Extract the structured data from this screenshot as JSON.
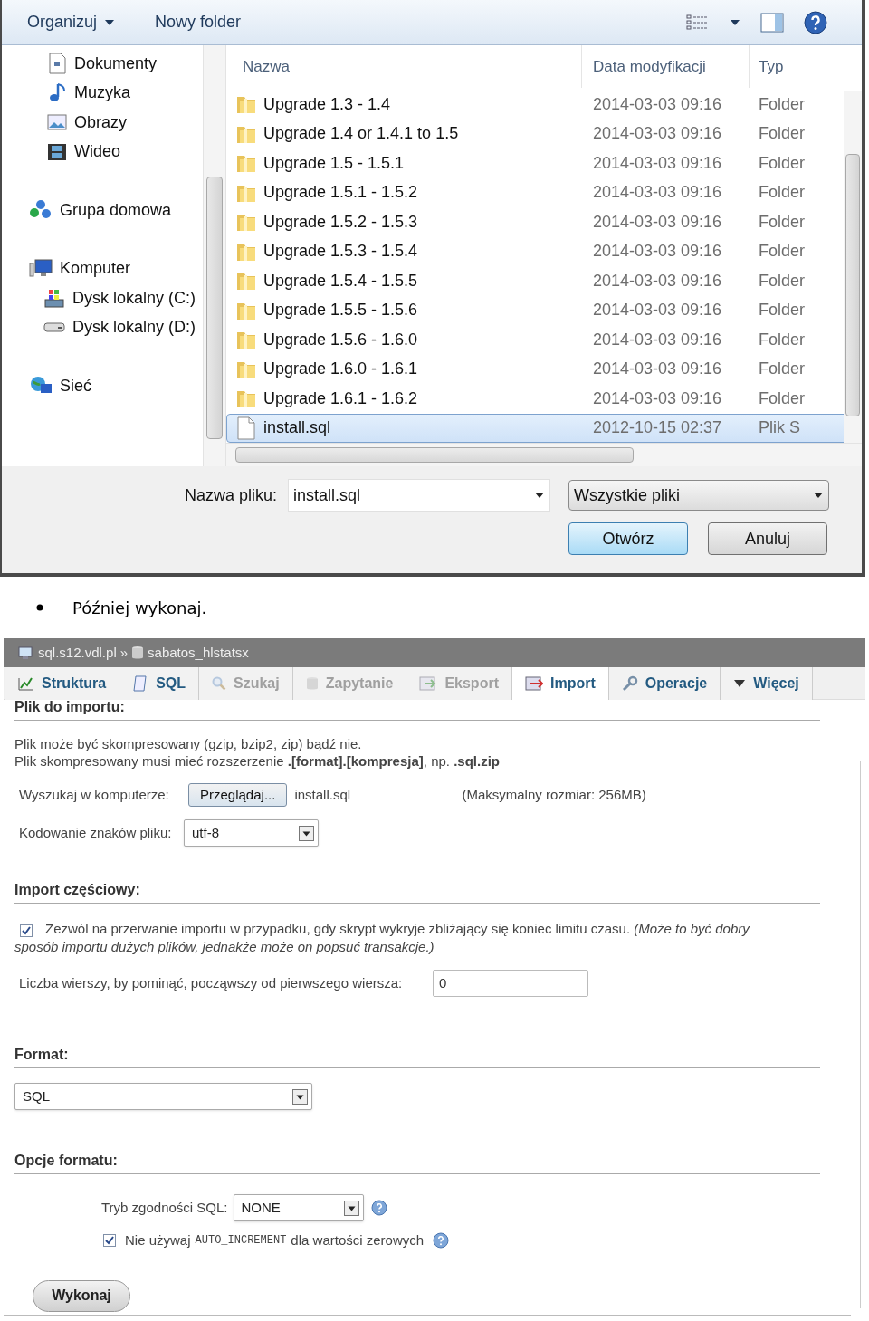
{
  "dialog": {
    "toolbar": {
      "organize": "Organizuj",
      "new_folder": "Nowy folder"
    },
    "nav": [
      {
        "children": [
          {
            "label": "Dokumenty"
          },
          {
            "label": "Muzyka"
          },
          {
            "label": "Obrazy"
          },
          {
            "label": "Wideo"
          }
        ]
      },
      {
        "label": "Grupa domowa"
      },
      {
        "label": "Komputer",
        "children": [
          {
            "label": "Dysk lokalny (C:)"
          },
          {
            "label": "Dysk lokalny (D:)"
          }
        ]
      },
      {
        "label": "Sieć"
      }
    ],
    "columns": [
      "Nazwa",
      "Data modyfikacji",
      "Typ"
    ],
    "rows": [
      {
        "name": "Upgrade 1.3 - 1.4",
        "date": "2014-03-03 09:16",
        "type": "Folder",
        "kind": "folder",
        "selected": false
      },
      {
        "name": "Upgrade 1.4 or 1.4.1 to 1.5",
        "date": "2014-03-03 09:16",
        "type": "Folder",
        "kind": "folder",
        "selected": false
      },
      {
        "name": "Upgrade 1.5 - 1.5.1",
        "date": "2014-03-03 09:16",
        "type": "Folder",
        "kind": "folder",
        "selected": false
      },
      {
        "name": "Upgrade 1.5.1 - 1.5.2",
        "date": "2014-03-03 09:16",
        "type": "Folder",
        "kind": "folder",
        "selected": false
      },
      {
        "name": "Upgrade 1.5.2 - 1.5.3",
        "date": "2014-03-03 09:16",
        "type": "Folder",
        "kind": "folder",
        "selected": false
      },
      {
        "name": "Upgrade 1.5.3 - 1.5.4",
        "date": "2014-03-03 09:16",
        "type": "Folder",
        "kind": "folder",
        "selected": false
      },
      {
        "name": "Upgrade 1.5.4 - 1.5.5",
        "date": "2014-03-03 09:16",
        "type": "Folder",
        "kind": "folder",
        "selected": false
      },
      {
        "name": "Upgrade 1.5.5 - 1.5.6",
        "date": "2014-03-03 09:16",
        "type": "Folder",
        "kind": "folder",
        "selected": false
      },
      {
        "name": "Upgrade 1.5.6 - 1.6.0",
        "date": "2014-03-03 09:16",
        "type": "Folder",
        "kind": "folder",
        "selected": false
      },
      {
        "name": "Upgrade 1.6.0 - 1.6.1",
        "date": "2014-03-03 09:16",
        "type": "Folder",
        "kind": "folder",
        "selected": false
      },
      {
        "name": "Upgrade 1.6.1 - 1.6.2",
        "date": "2014-03-03 09:16",
        "type": "Folder",
        "kind": "folder",
        "selected": false
      },
      {
        "name": "install.sql",
        "date": "2012-10-15 02:37",
        "type": "Plik S",
        "kind": "file",
        "selected": true
      }
    ],
    "filename_label": "Nazwa pliku:",
    "filename_value": "install.sql",
    "filter": "Wszystkie pliki",
    "buttons": [
      {
        "label": "Otwórz",
        "default": true
      },
      {
        "label": "Anuluj",
        "default": false
      }
    ]
  },
  "bullet": "Później wykonaj.",
  "pma": {
    "breadcrumb": [
      "sql.s12.vdl.pl",
      "sabatos_hlstatsx"
    ],
    "breadcrumb_separator": "»",
    "tabs": [
      {
        "label": "Struktura",
        "selected": false,
        "disabled": false
      },
      {
        "label": "SQL",
        "selected": false,
        "disabled": false
      },
      {
        "label": "Szukaj",
        "selected": false,
        "disabled": true
      },
      {
        "label": "Zapytanie",
        "selected": false,
        "disabled": true
      },
      {
        "label": "Eksport",
        "selected": false,
        "disabled": true
      },
      {
        "label": "Import",
        "selected": true,
        "disabled": false
      },
      {
        "label": "Operacje",
        "selected": false,
        "disabled": false
      },
      {
        "label": "Więcej",
        "selected": false,
        "disabled": false
      }
    ],
    "file_section": {
      "heading": "Plik do importu:",
      "notes": [
        "Plik może być skompresowany (gzip, bzip2, zip) bądź nie.",
        "Plik skompresowany musi mieć rozszerzenie **.[format].[kompresja]**, np. **.sql.zip**"
      ],
      "browse_label": "Wyszukaj w komputerze:",
      "browse_button": "Przeglądaj...",
      "chosen_file": "install.sql",
      "max_size": "(Maksymalny rozmiar: 256MB)",
      "charset_label": "Kodowanie znaków pliku:",
      "charset": "utf-8"
    },
    "partial_section": {
      "heading": "Import częściowy:",
      "allow_interrupt": {
        "checked": true,
        "text": "Zezwól na przerwanie importu w przypadku, gdy skrypt wykryje zbliżający się koniec limitu czasu. *(Może to być dobry sposób importu dużych plików, jednakże może on popsuć transakcje.)*"
      },
      "skip_label": "Liczba wierszy, by pominąć, począwszy od pierwszego wiersza:",
      "skip_value": "0"
    },
    "format_section": {
      "heading": "Format:",
      "format": "SQL"
    },
    "options_section": {
      "heading": "Opcje formatu:",
      "compat_label": "Tryb zgodności SQL:",
      "compat": "NONE",
      "no_auto_increment": {
        "checked": true,
        "before": "Nie używaj",
        "code": "AUTO_INCREMENT",
        "after": "dla wartości zerowych"
      }
    },
    "submit": "Wykonaj"
  }
}
